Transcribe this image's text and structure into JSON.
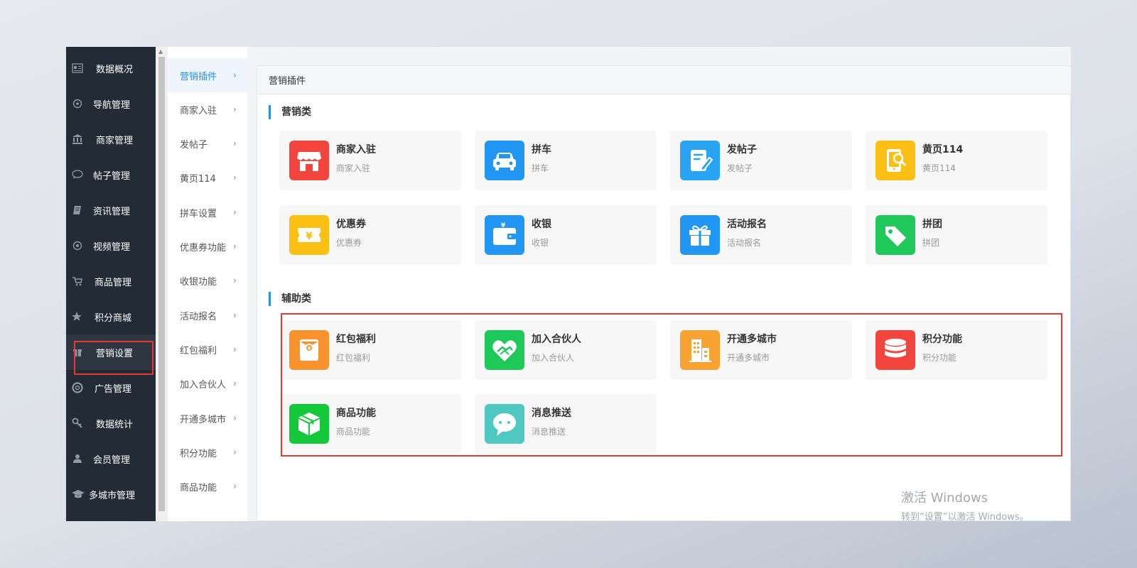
{
  "nav": {
    "items": [
      {
        "label": "数据概况",
        "icon": "dashboard-icon"
      },
      {
        "label": "导航管理",
        "icon": "compass-icon"
      },
      {
        "label": "商家管理",
        "icon": "bank-icon"
      },
      {
        "label": "帖子管理",
        "icon": "comment-icon"
      },
      {
        "label": "资讯管理",
        "icon": "book-icon"
      },
      {
        "label": "视频管理",
        "icon": "video-icon"
      },
      {
        "label": "商品管理",
        "icon": "cart-icon"
      },
      {
        "label": "积分商城",
        "icon": "star-icon"
      },
      {
        "label": "营销设置",
        "icon": "gift-icon"
      },
      {
        "label": "广告管理",
        "icon": "lifebuoy-icon"
      },
      {
        "label": "数据统计",
        "icon": "key-icon"
      },
      {
        "label": "会员管理",
        "icon": "user-icon"
      },
      {
        "label": "多城市管理",
        "icon": "graduation-cap-icon"
      }
    ],
    "active_index": 8
  },
  "submenu": {
    "items": [
      "营销插件",
      "商家入驻",
      "发帖子",
      "黄页114",
      "拼车设置",
      "优惠券功能",
      "收银功能",
      "活动报名",
      "红包福利",
      "加入合伙人",
      "开通多城市",
      "积分功能",
      "商品功能"
    ],
    "active_index": 0,
    "chevron": "›"
  },
  "panel": {
    "title": "营销插件"
  },
  "sections": {
    "marketing": {
      "title": "营销类",
      "cards": [
        {
          "title": "商家入驻",
          "desc": "商家入驻",
          "color": "#f2453d",
          "icon": "store-icon"
        },
        {
          "title": "拼车",
          "desc": "拼车",
          "color": "#2196f3",
          "icon": "car-icon"
        },
        {
          "title": "发帖子",
          "desc": "发帖子",
          "color": "#29a4f2",
          "icon": "edit-post-icon"
        },
        {
          "title": "黄页114",
          "desc": "黄页114",
          "color": "#fcbf14",
          "icon": "phone-search-icon"
        },
        {
          "title": "优惠券",
          "desc": "优惠券",
          "color": "#fcbf14",
          "icon": "coupon-icon"
        },
        {
          "title": "收银",
          "desc": "收银",
          "color": "#2196f3",
          "icon": "wallet-icon"
        },
        {
          "title": "活动报名",
          "desc": "活动报名",
          "color": "#2196f3",
          "icon": "gift-box-icon"
        },
        {
          "title": "拼团",
          "desc": "拼团",
          "color": "#1ec95a",
          "icon": "tag-icon"
        }
      ]
    },
    "auxiliary": {
      "title": "辅助类",
      "cards": [
        {
          "title": "红包福利",
          "desc": "红包福利",
          "color": "#f8932e",
          "icon": "red-envelope-icon"
        },
        {
          "title": "加入合伙人",
          "desc": "加入合伙人",
          "color": "#1ec95a",
          "icon": "handshake-icon"
        },
        {
          "title": "开通多城市",
          "desc": "开通多城市",
          "color": "#f8a232",
          "icon": "buildings-icon"
        },
        {
          "title": "积分功能",
          "desc": "积分功能",
          "color": "#f2453d",
          "icon": "database-icon"
        },
        {
          "title": "商品功能",
          "desc": "商品功能",
          "color": "#13c93a",
          "icon": "package-icon"
        },
        {
          "title": "消息推送",
          "desc": "消息推送",
          "color": "#4fc8c2",
          "icon": "chat-bubble-icon"
        }
      ]
    }
  },
  "watermark": {
    "line1": "激活 Windows",
    "line2": "转到“设置”以激活 Windows。"
  },
  "colors": {
    "accent": "#2d8cf0",
    "highlight": "#e53935",
    "nav_bg": "#222b36"
  }
}
